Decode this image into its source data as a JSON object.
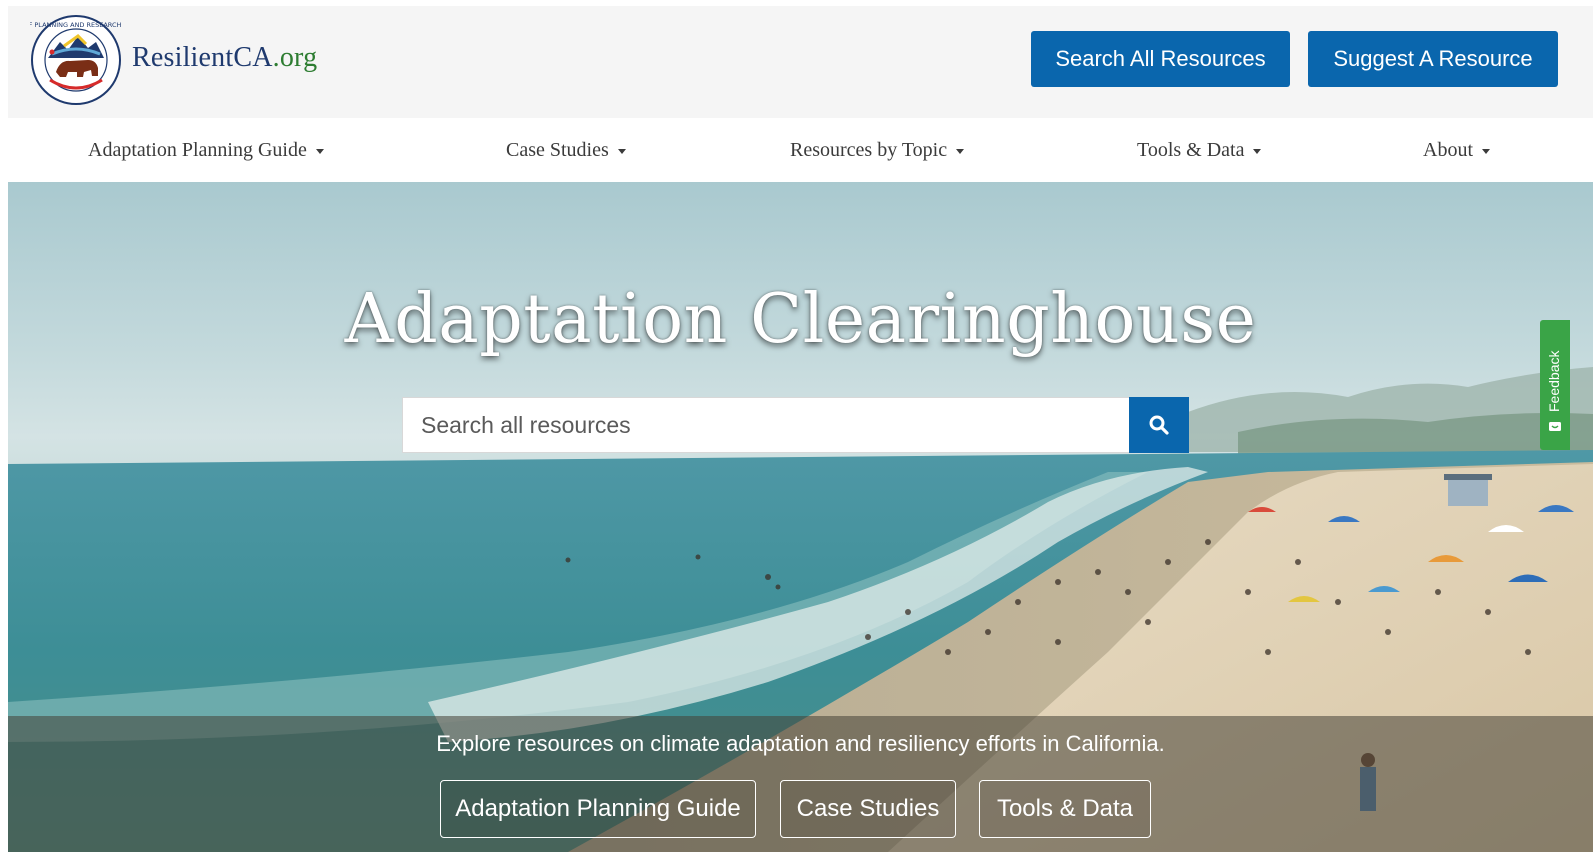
{
  "header": {
    "logo_seal_text": "GOVERNOR'S OFFICE OF PLANNING AND RESEARCH · STATE OF CALIFORNIA",
    "logo_name": "ResilientCA",
    "logo_tld": ".org",
    "search_all_label": "Search All Resources",
    "suggest_label": "Suggest A Resource"
  },
  "nav": {
    "items": [
      {
        "label": "Adaptation Planning Guide"
      },
      {
        "label": "Case Studies"
      },
      {
        "label": "Resources by Topic"
      },
      {
        "label": "Tools & Data"
      },
      {
        "label": "About"
      }
    ]
  },
  "hero": {
    "title": "Adaptation Clearinghouse",
    "search_placeholder": "Search all resources",
    "tagline": "Explore resources on climate adaptation and resiliency efforts in California.",
    "buttons": [
      {
        "label": "Adaptation Planning Guide"
      },
      {
        "label": "Case Studies"
      },
      {
        "label": "Tools & Data"
      }
    ]
  },
  "feedback": {
    "label": "Feedback"
  },
  "colors": {
    "primary_blue": "#0a66ad",
    "feedback_green": "#3aa447",
    "logo_navy": "#1f3a6e",
    "logo_green": "#2e7d32"
  },
  "icons": [
    "state-seal-icon",
    "caret-down-icon",
    "search-icon",
    "feedback-icon"
  ]
}
